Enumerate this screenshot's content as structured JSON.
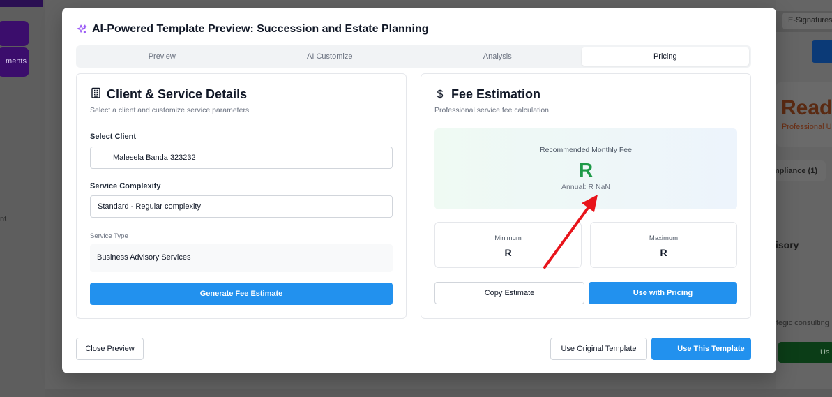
{
  "background": {
    "sidebar_partial_label": "ments",
    "sidebar_partial_text": "nt",
    "tab_partial": "E-Signatures",
    "ready_partial": "Ready",
    "professional_partial": "Professional U",
    "compliance_partial": "mpliance (1)",
    "advisory_partial": "isory",
    "strategic_partial": "tegic consulting",
    "green_button_partial": "Us"
  },
  "modal": {
    "title": "AI-Powered Template Preview: Succession and Estate Planning",
    "tabs": [
      {
        "label": "Preview",
        "active": false
      },
      {
        "label": "AI Customize",
        "active": false
      },
      {
        "label": "Analysis",
        "active": false
      },
      {
        "label": "Pricing",
        "active": true
      }
    ],
    "client_panel": {
      "title": "Client & Service Details",
      "subtitle": "Select a client and customize service parameters",
      "select_client_label": "Select Client",
      "select_client_value": "Malesela Banda 323232",
      "complexity_label": "Service Complexity",
      "complexity_value": "Standard - Regular complexity",
      "service_type_label": "Service Type",
      "service_type_value": "Business Advisory Services",
      "generate_button": "Generate Fee Estimate"
    },
    "fee_panel": {
      "title": "Fee Estimation",
      "subtitle": "Professional service fee calculation",
      "recommended_label": "Recommended Monthly Fee",
      "recommended_value": "R",
      "annual_text": "Annual: R NaN",
      "minimum_label": "Minimum",
      "minimum_value": "R",
      "maximum_label": "Maximum",
      "maximum_value": "R",
      "copy_button": "Copy Estimate",
      "use_pricing_button": "Use with Pricing"
    },
    "footer": {
      "close_button": "Close Preview",
      "use_original_button": "Use Original Template",
      "use_this_button": "Use This Template"
    }
  },
  "colors": {
    "primary": "#2291ee",
    "fee_green": "#1e9a48",
    "annotation_arrow": "#e8141b",
    "sparkle": "#9b5cf6"
  }
}
